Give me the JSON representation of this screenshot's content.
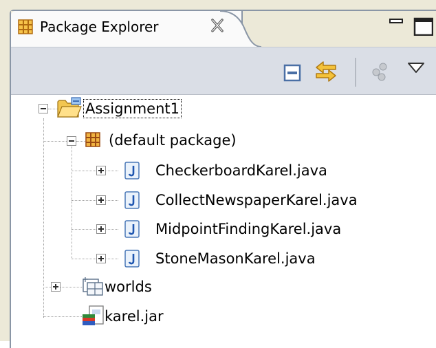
{
  "view": {
    "title": "Package Explorer"
  },
  "tree": {
    "project": {
      "label": "Assignment1"
    },
    "package": {
      "label": "(default package)"
    },
    "files": [
      {
        "label": "CheckerboardKarel.java"
      },
      {
        "label": "CollectNewspaperKarel.java"
      },
      {
        "label": "MidpointFindingKarel.java"
      },
      {
        "label": "StoneMasonKarel.java"
      }
    ],
    "folder": {
      "label": "worlds"
    },
    "jar": {
      "label": "karel.jar"
    }
  },
  "icons": {
    "view": "package-explorer-icon",
    "project": "project-folder-icon",
    "package": "package-icon",
    "java_file": "java-file-icon",
    "folder": "source-folder-icon",
    "jar": "jar-icon"
  },
  "colors": {
    "toolbar": "#dadee6",
    "frame": "#ece9d8",
    "border": "#8a96a6"
  }
}
